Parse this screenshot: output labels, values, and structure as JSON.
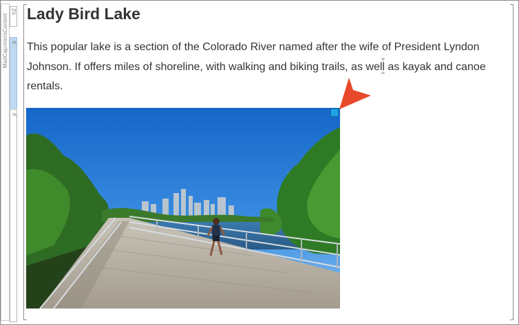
{
  "structure_bar": {
    "outer_label": "MadCap:microContent",
    "tags": {
      "h2": "h2",
      "p1": "p",
      "p2": "p"
    }
  },
  "content": {
    "title": "Lady Bird Lake",
    "paragraph": "This popular lake is a section of the Colorado River named after the wife of President Lyndon Johnson. If offers miles of shoreline, with walking and biking trails, as well as kayak and canoe rentals."
  },
  "image": {
    "subject": "lake-boardwalk-runner-skyline"
  },
  "colors": {
    "accent_arrow": "#e8492a",
    "handle": "#1fa3e6",
    "selected_tag": "#bfd9f1"
  }
}
